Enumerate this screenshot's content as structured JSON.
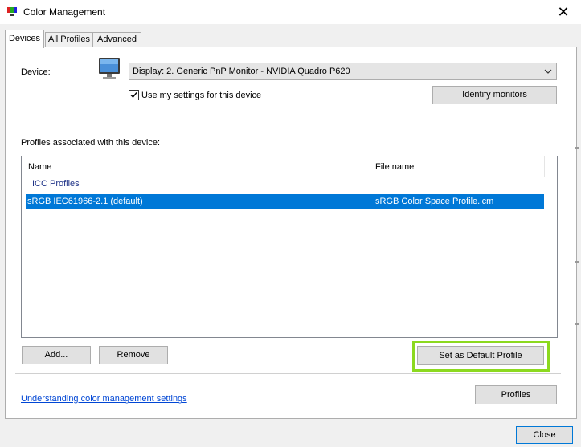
{
  "window": {
    "title": "Color Management",
    "close_glyph": "✕"
  },
  "tabs": [
    {
      "label": "Devices",
      "active": true
    },
    {
      "label": "All Profiles",
      "active": false
    },
    {
      "label": "Advanced",
      "active": false
    }
  ],
  "device": {
    "label": "Device:",
    "selected": "Display: 2. Generic PnP Monitor - NVIDIA Quadro P620",
    "use_my_settings_label": "Use my settings for this device",
    "use_my_settings_checked": true,
    "identify_button": "Identify monitors",
    "icon": "monitor-icon"
  },
  "profiles": {
    "section_label": "Profiles associated with this device:",
    "columns": [
      "Name",
      "File name"
    ],
    "group": "ICC Profiles",
    "rows": [
      {
        "name": "sRGB IEC61966-2.1 (default)",
        "file": "sRGB Color Space Profile.icm",
        "selected": true
      }
    ]
  },
  "buttons": {
    "add": "Add...",
    "remove": "Remove",
    "set_default": "Set as Default Profile",
    "profiles": "Profiles",
    "close": "Close"
  },
  "link": "Understanding color management settings",
  "colors": {
    "selection": "#0078d7",
    "highlight_box": "#8cd91f",
    "link": "#0046d5"
  }
}
